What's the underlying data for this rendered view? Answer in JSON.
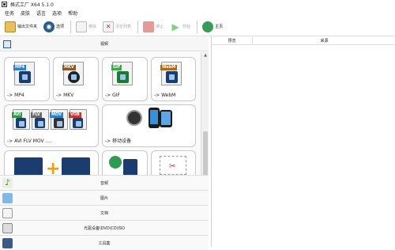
{
  "window": {
    "title": "格式工厂 X64 5.1.0"
  },
  "menu": [
    "任务",
    "皮肤",
    "语言",
    "选项",
    "帮助"
  ],
  "toolbar": {
    "output_folder": "输出文件夹",
    "options": "选项",
    "remove": "移除",
    "clear_list": "清空列表",
    "stop": "停止",
    "start": "开始",
    "home": "主页"
  },
  "video_section": {
    "title": "视频",
    "tiles": [
      {
        "caption": "-> MP4",
        "tag": "MP4",
        "color": "#2f7fd1"
      },
      {
        "caption": "-> MKV",
        "tag": "MKV",
        "color": "#8a5a2a"
      },
      {
        "caption": "-> GIF",
        "tag": "GIF",
        "color": "#3ca84a"
      },
      {
        "caption": "-> WebM",
        "tag": "WebM",
        "color": "#b06a1c"
      },
      {
        "caption": "-> AVI FLV MOV ....",
        "tags": [
          "AVI",
          "FLV",
          "MOV",
          "VOB"
        ]
      },
      {
        "caption": "-> 移动设备"
      }
    ]
  },
  "categories": [
    "音频",
    "图片",
    "文档",
    "光驱设备\\DVD\\CD\\ISO",
    "工具集"
  ],
  "task_list": {
    "columns": [
      "预览",
      "来源"
    ]
  },
  "colors": {
    "accent": "#2a5d8c",
    "disabled": "#aaaaaa",
    "border": "#c8c8c8"
  }
}
